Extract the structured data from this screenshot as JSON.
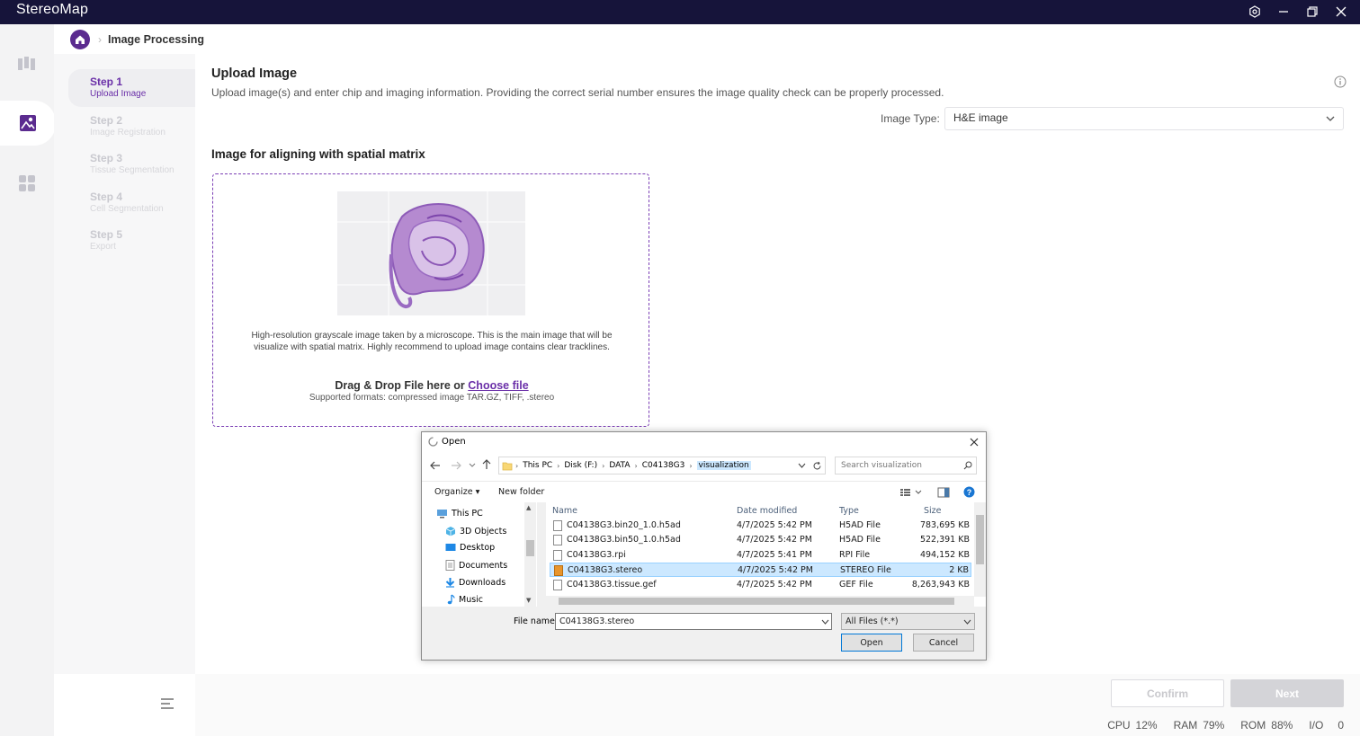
{
  "app": {
    "title": "StereoMap"
  },
  "breadcrumb": {
    "current": "Image Processing"
  },
  "steps": [
    {
      "title": "Step 1",
      "sub": "Upload Image"
    },
    {
      "title": "Step 2",
      "sub": "Image Registration"
    },
    {
      "title": "Step 3",
      "sub": "Tissue Segmentation"
    },
    {
      "title": "Step 4",
      "sub": "Cell Segmentation"
    },
    {
      "title": "Step 5",
      "sub": "Export"
    }
  ],
  "main": {
    "title": "Upload Image",
    "description": "Upload image(s) and enter chip and imaging information. Providing the correct serial number ensures the image quality check can be properly processed.",
    "image_type_label": "Image Type:",
    "image_type_value": "H&E image",
    "section_title": "Image for aligning with spatial matrix",
    "dropzone": {
      "description": "High-resolution grayscale image taken by a microscope. This is the main image that will be visualize with spatial matrix. Highly recommend to upload image contains clear tracklines.",
      "drag_text": "Drag & Drop File here or ",
      "choose_link": "Choose file",
      "formats": "Supported formats: compressed image TAR.GZ, TIFF, .stereo"
    }
  },
  "footer": {
    "confirm_label": "Confirm",
    "next_label": "Next",
    "stats": {
      "cpu_label": "CPU",
      "cpu_value": "12%",
      "ram_label": "RAM",
      "ram_value": "79%",
      "rom_label": "ROM",
      "rom_value": "88%",
      "io_label": "I/O",
      "io_value": "0"
    }
  },
  "dialog": {
    "title": "Open",
    "path": [
      "This PC",
      "Disk (F:)",
      "DATA",
      "C04138G3",
      "visualization"
    ],
    "search_placeholder": "Search visualization",
    "organize_label": "Organize",
    "new_folder_label": "New folder",
    "tree": [
      {
        "label": "This PC",
        "icon": "computer-icon"
      },
      {
        "label": "3D Objects",
        "icon": "cube-icon"
      },
      {
        "label": "Desktop",
        "icon": "desktop-icon"
      },
      {
        "label": "Documents",
        "icon": "document-icon"
      },
      {
        "label": "Downloads",
        "icon": "download-icon"
      },
      {
        "label": "Music",
        "icon": "music-icon"
      }
    ],
    "columns": {
      "name": "Name",
      "date": "Date modified",
      "type": "Type",
      "size": "Size"
    },
    "files": [
      {
        "name": "C04138G3.bin20_1.0.h5ad",
        "date": "4/7/2025 5:42 PM",
        "type": "H5AD File",
        "size": "783,695 KB"
      },
      {
        "name": "C04138G3.bin50_1.0.h5ad",
        "date": "4/7/2025 5:42 PM",
        "type": "H5AD File",
        "size": "522,391 KB"
      },
      {
        "name": "C04138G3.rpi",
        "date": "4/7/2025 5:41 PM",
        "type": "RPI File",
        "size": "494,152 KB"
      },
      {
        "name": "C04138G3.stereo",
        "date": "4/7/2025 5:42 PM",
        "type": "STEREO File",
        "size": "2 KB"
      },
      {
        "name": "C04138G3.tissue.gef",
        "date": "4/7/2025 5:42 PM",
        "type": "GEF File",
        "size": "8,263,943 KB"
      }
    ],
    "filename_label": "File name:",
    "filename_value": "C04138G3.stereo",
    "filetype_value": "All Files (*.*)",
    "open_label": "Open",
    "cancel_label": "Cancel"
  },
  "colors": {
    "titlebar": "#16143a",
    "accent": "#6a2fa8",
    "selection": "#cce8ff"
  }
}
